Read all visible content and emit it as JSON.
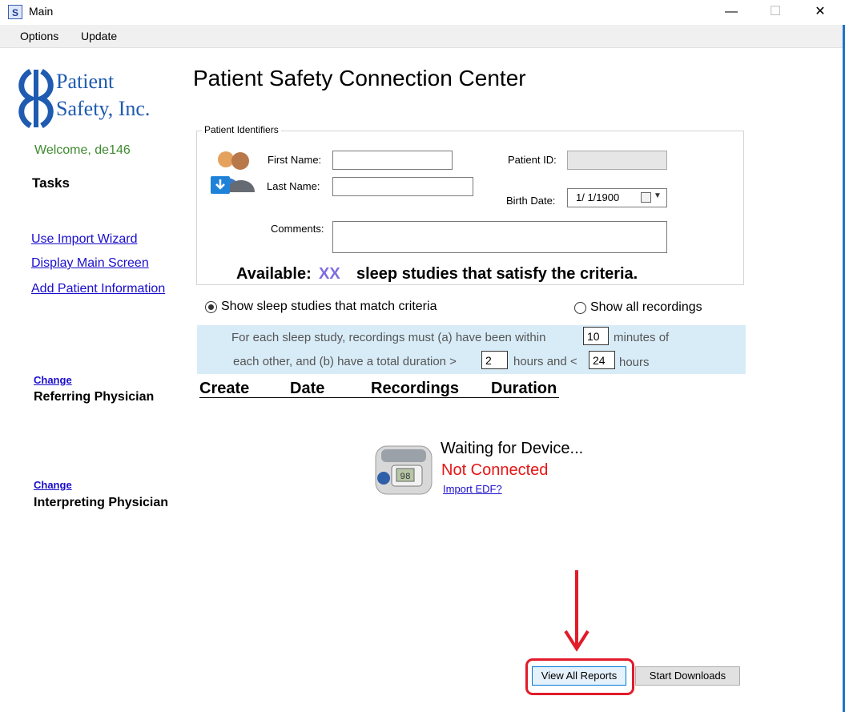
{
  "window": {
    "title": "Main",
    "app_icon": "ps-app-icon",
    "app_icon_glyph": "S",
    "minimize_glyph": "—",
    "maximize_glyph": "☐",
    "close_glyph": "✕"
  },
  "menu": [
    "Options",
    "Update"
  ],
  "sidebar": {
    "logo_line1": "Patient",
    "logo_line2": "Safety, Inc.",
    "welcome": "Welcome, de146",
    "tasks_heading": "Tasks",
    "links": [
      "Use Import Wizard",
      "Display Main Screen",
      "Add Patient Information"
    ],
    "referring": {
      "change": "Change",
      "label": "Referring Physician"
    },
    "interpreting": {
      "change": "Change",
      "label": "Interpreting Physician"
    }
  },
  "main": {
    "title": "Patient Safety Connection Center",
    "group_label": "Patient Identifiers",
    "first_name_label": "First Name:",
    "first_name_value": "",
    "last_name_label": "Last Name:",
    "last_name_value": "",
    "patient_id_label": "Patient ID:",
    "patient_id_value": "",
    "birth_date_label": "Birth Date:",
    "birth_date_value": "1/  1/1900",
    "comments_label": "Comments:",
    "comments_value": "",
    "available_prefix": "Available:",
    "available_count": "XX",
    "available_suffix": "sleep studies that satisfy the criteria.",
    "radio_match": "Show sleep studies that match criteria",
    "radio_all": "Show all recordings",
    "radio_match_selected": true,
    "criteria": {
      "line1_a": "For each sleep study, recordings must (a) have been within",
      "within_minutes": "10",
      "line1_b": "minutes of",
      "line2_a": "each other, and (b) have a total duration >",
      "min_hours": "2",
      "line2_b": "hours and <",
      "max_hours": "24",
      "line2_c": "hours"
    },
    "columns": [
      "Create",
      "Date",
      "Recordings",
      "Duration"
    ],
    "device": {
      "icon": "sleep-device-icon",
      "screen_reading": "98",
      "waiting": "Waiting for Device...",
      "status": "Not Connected",
      "import_link": "Import EDF?"
    },
    "buttons": {
      "view_reports": "View All Reports",
      "start_downloads": "Start Downloads"
    }
  },
  "colors": {
    "brand": "#1f5bb0",
    "welcome": "#3d8b2f",
    "status_error": "#e51515",
    "count": "#7f6de0",
    "annotation": "#e11b2a",
    "criteria_bg": "#d8ecf8"
  }
}
